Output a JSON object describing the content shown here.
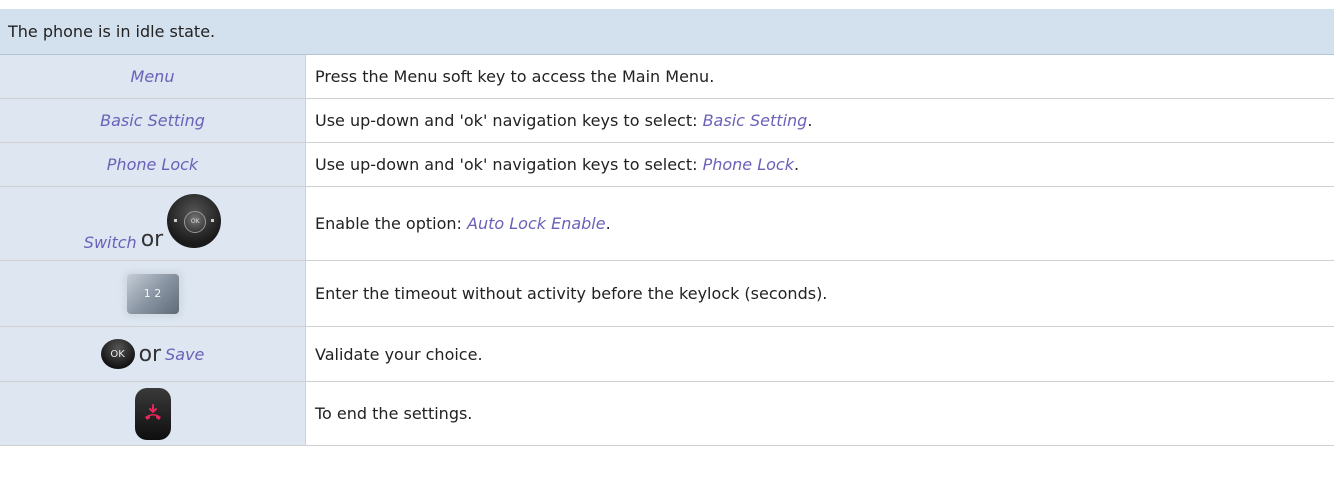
{
  "header": {
    "text": "The phone is in idle state."
  },
  "rows": [
    {
      "key_label": "Menu",
      "description": "Press the Menu soft key to access the Main Menu."
    },
    {
      "key_label": "Basic Setting",
      "description_prefix": "Use up-down and 'ok' navigation keys to select: ",
      "description_em": "Basic Setting",
      "description_suffix": "."
    },
    {
      "key_label": "Phone Lock",
      "description_prefix": "Use up-down and 'ok' navigation keys to select: ",
      "description_em": "Phone Lock",
      "description_suffix": "."
    },
    {
      "key_label": "Switch",
      "or": "or",
      "icon": "navigator-icon",
      "nav_ok": "OK",
      "description_prefix": "Enable the option: ",
      "description_em": "Auto Lock Enable",
      "description_suffix": "."
    },
    {
      "icon": "keypad-icon",
      "keypad_glyph": "1 2",
      "description": "Enter the timeout without activity before the keylock (seconds)."
    },
    {
      "icon": "ok-key-icon",
      "ok_glyph": "OK",
      "or": "or",
      "key_label": "Save",
      "description": "Validate your choice."
    },
    {
      "icon": "end-call-icon",
      "description": "To end the settings."
    }
  ],
  "colors": {
    "header_bg": "#d3e0ee",
    "key_cell_bg": "#dde6f1",
    "soft_key_text": "#6a62b8",
    "end_call_red": "#e8265a"
  }
}
